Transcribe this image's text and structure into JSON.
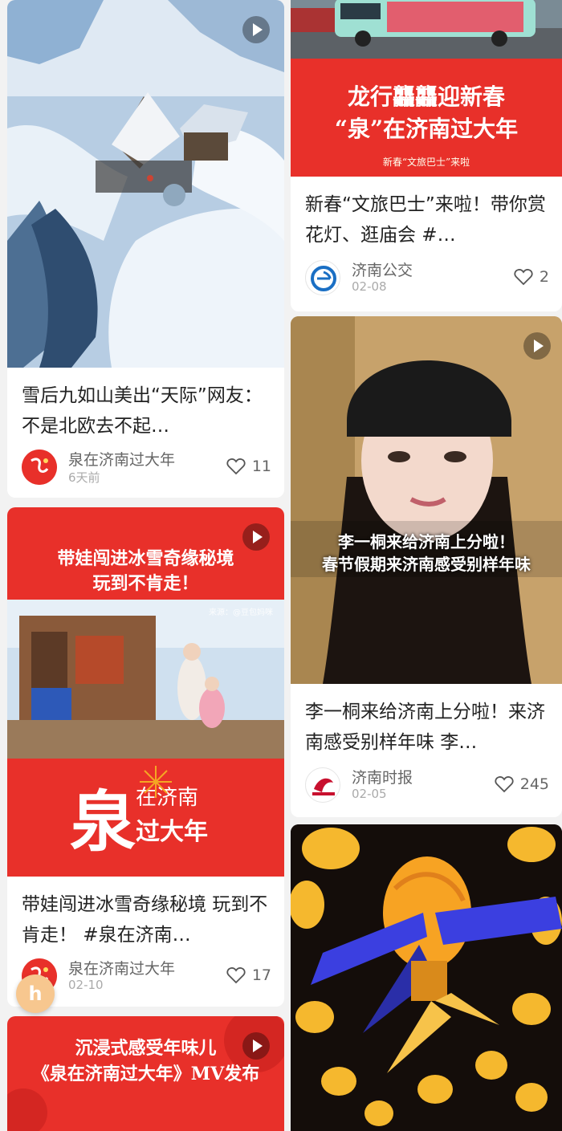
{
  "cards": [
    {
      "title": "雪后九如山美出“天际”网友：不是北欧去不起…",
      "author": "泉在济南过大年",
      "date": "6天前",
      "likes": "11",
      "avatar_text": "泉在济南过大年"
    },
    {
      "title": "新春“文旅巴士”来啦！带你赏花灯、逛庙会 #…",
      "author": "济南公交",
      "date": "02-08",
      "likes": "2",
      "banner_line1": "龙行龘龘迎新春",
      "banner_line2": "“泉”在济南过大年",
      "banner_line3": "新春“文旅巴士”来啦"
    },
    {
      "title": "李一桐来给济南上分啦！来济南感受别样年味 李…",
      "author": "济南时报",
      "date": "02-05",
      "likes": "245",
      "caption_line1": "李一桐来给济南上分啦！",
      "caption_line2": "春节假期来济南感受别样年味"
    },
    {
      "title": "带娃闯进冰雪奇缘秘境 玩到不肯走！ #泉在济南…",
      "author": "泉在济南过大年",
      "date": "02-10",
      "likes": "17",
      "banner_line1": "带娃闯进冰雪奇缘秘境",
      "banner_line2": "玩到不肯走！",
      "photo_watermark": "来源：@豆包妈咪",
      "logo_char": "泉",
      "logo_small1": "在济南",
      "logo_small2": "过大年"
    },
    {
      "banner_line1": "沉浸式感受年味儿",
      "banner_line2": "《泉在济南过大年》MV发布"
    }
  ],
  "fab_label": "h",
  "colors": {
    "brand_red": "#e8302a",
    "text": "#222222",
    "muted": "#999999"
  }
}
